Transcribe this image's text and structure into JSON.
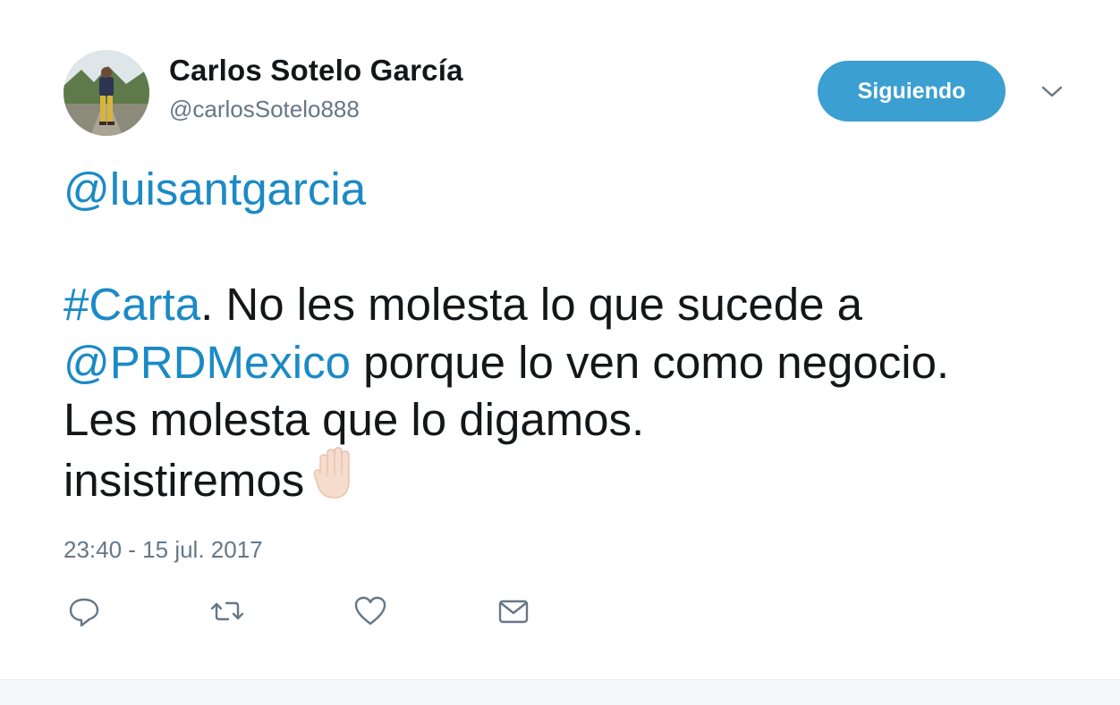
{
  "author": {
    "display_name": "Carlos Sotelo García",
    "handle": "@carlosSotelo888",
    "avatar_icon": "profile-photo"
  },
  "header": {
    "follow_button_label": "Siguiendo",
    "menu_icon": "chevron-down-icon"
  },
  "tweet": {
    "mention_1": "@luisantgarcia",
    "hashtag": "#Carta",
    "text_line_1": ". No les molesta lo que sucede a",
    "mention_2": "@PRDMexico",
    "text_line_2": " porque lo ven como negocio.",
    "text_line_3": "Les molesta que lo digamos.",
    "text_line_4": "insistiremos",
    "emoji": "raised-hand-emoji",
    "timestamp": "23:40 - 15 jul. 2017"
  },
  "actions": [
    {
      "name": "reply",
      "icon": "reply-icon"
    },
    {
      "name": "retweet",
      "icon": "retweet-icon"
    },
    {
      "name": "like",
      "icon": "heart-icon"
    },
    {
      "name": "direct-message",
      "icon": "envelope-icon"
    }
  ],
  "colors": {
    "link": "#1b8ac5",
    "follow_button": "#3b9fd1",
    "text": "#14171a",
    "secondary_text": "#657786",
    "icon": "#657786"
  }
}
